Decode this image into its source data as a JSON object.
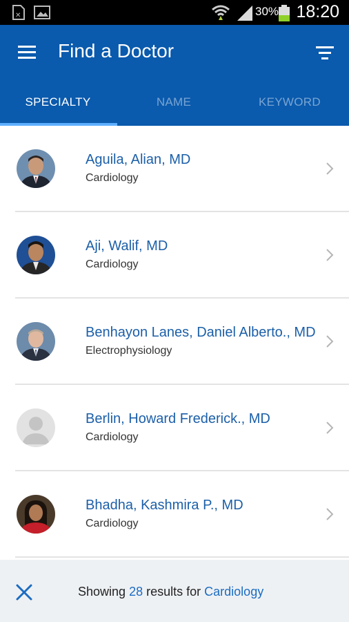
{
  "status_bar": {
    "battery_percent": "30%",
    "time": "18:20",
    "icons": [
      "sim-card-icon",
      "gallery-icon",
      "wifi-icon",
      "signal-icon",
      "battery-icon"
    ]
  },
  "app_bar": {
    "title": "Find a Doctor",
    "background_color": "#0a5aad",
    "icons": [
      "menu-icon",
      "filter-icon"
    ]
  },
  "tabs": [
    {
      "label": "SPECIALTY",
      "active": true
    },
    {
      "label": "NAME",
      "active": false
    },
    {
      "label": "KEYWORD",
      "active": false
    }
  ],
  "doctors": [
    {
      "name": "Aguila, Alian, MD",
      "specialty": "Cardiology",
      "avatar": "photo"
    },
    {
      "name": "Aji, Walif, MD",
      "specialty": "Cardiology",
      "avatar": "photo"
    },
    {
      "name": "Benhayon Lanes, Daniel Alberto., MD",
      "specialty": "Electrophysiology",
      "avatar": "photo"
    },
    {
      "name": "Berlin, Howard Frederick., MD",
      "specialty": "Cardiology",
      "avatar": "placeholder"
    },
    {
      "name": "Bhadha, Kashmira P., MD",
      "specialty": "Cardiology",
      "avatar": "photo"
    }
  ],
  "footer": {
    "prefix": "Showing",
    "count": "28",
    "middle": "results for",
    "specialty": "Cardiology",
    "icon": "close-icon"
  }
}
